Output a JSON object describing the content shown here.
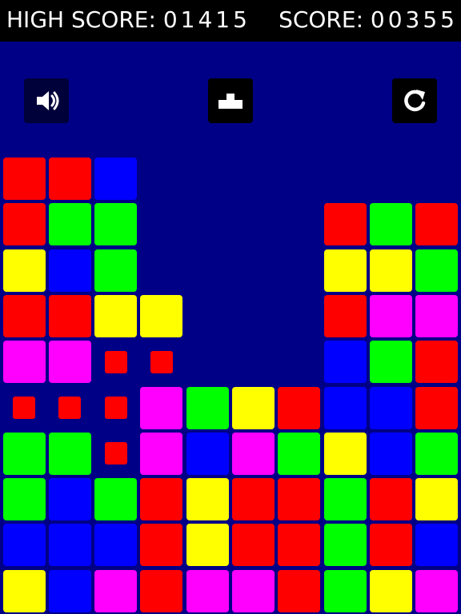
{
  "header": {
    "high_score_label": "HIGH SCORE:",
    "high_score_value": "01415",
    "score_label": "SCORE:",
    "score_value": "00355"
  },
  "toolbar": {
    "sound_icon": "speaker-icon",
    "podium_icon": "podium-icon",
    "restart_icon": "restart-icon"
  },
  "colors": {
    "background": "#000086",
    "R": "#ff0000",
    "G": "#00ff00",
    "B": "#0000ff",
    "Y": "#ffff00",
    "M": "#ff00ff",
    "X": "#ff0000"
  },
  "board": {
    "columns": 10,
    "rows": 10,
    "legend": {
      "R": "red",
      "G": "green",
      "B": "blue",
      "Y": "yellow",
      "M": "magenta",
      "X": "small-red-marker",
      ".": "empty"
    },
    "grid": [
      "RRB.......",
      "RGG....RGR",
      "YBG....YYG",
      "RRYY...RMM",
      "MMXX...BGR",
      "XXXMGYRBBR",
      "GGXMBMGYBG",
      "GBGRYRRGRY",
      "BBBRYRRGRB",
      "YBMRMMRGYM"
    ]
  }
}
